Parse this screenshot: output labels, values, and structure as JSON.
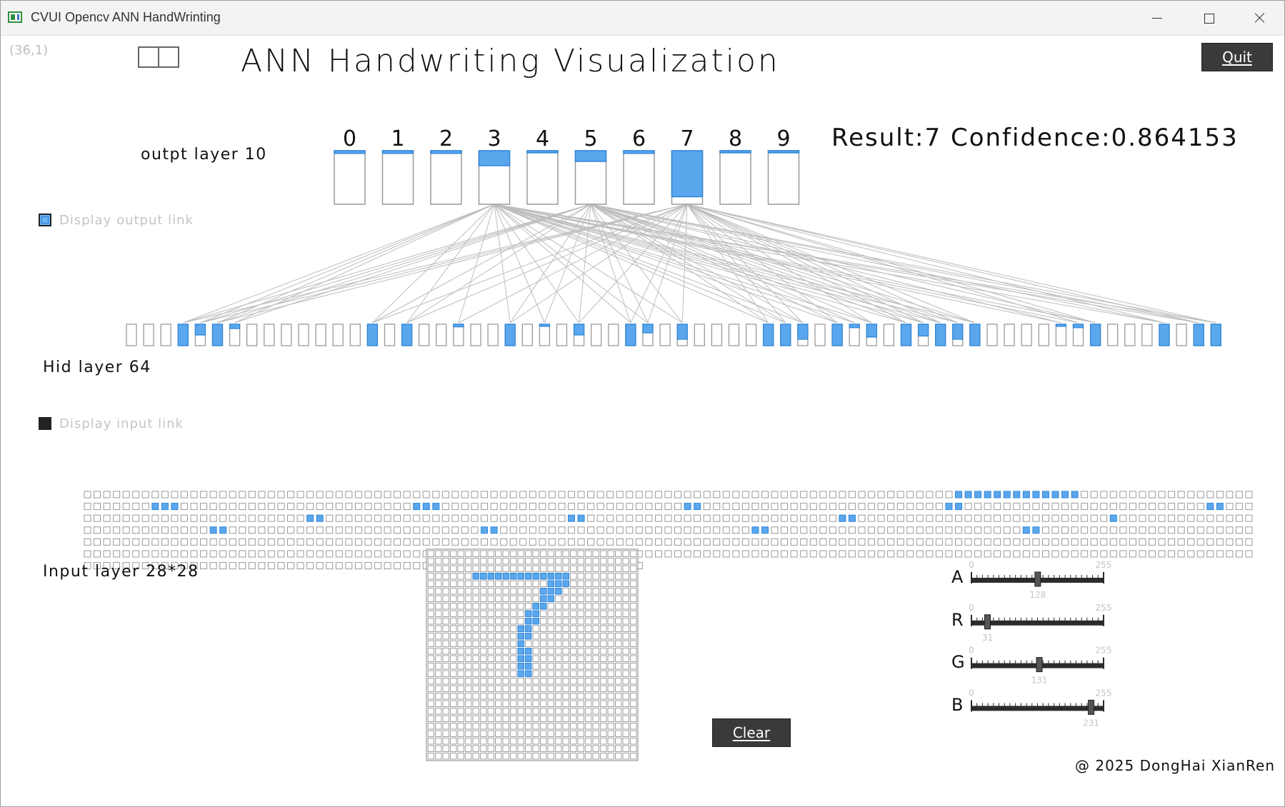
{
  "window": {
    "title": "CVUI Opencv ANN HandWrinting"
  },
  "header": {
    "coord_readout": "(36,1)",
    "title": "ANN Handwriting Visualization",
    "quit_label": "Quit"
  },
  "output_layer": {
    "label": "outpt layer 10",
    "digits": [
      "0",
      "1",
      "2",
      "3",
      "4",
      "5",
      "6",
      "7",
      "8",
      "9"
    ],
    "activations": [
      0.05,
      0.05,
      0.05,
      0.28,
      0.04,
      0.2,
      0.05,
      0.86,
      0.04,
      0.04
    ],
    "result_text": "Result:7  Confidence:0.864153",
    "display_link_label": "Display output link",
    "display_link_checked": true
  },
  "hidden_layer": {
    "label": "Hid layer 64",
    "activations": [
      0,
      0,
      0,
      1,
      0.5,
      1,
      0.2,
      0,
      0,
      0,
      0,
      0,
      0,
      0,
      1,
      0,
      1,
      0,
      0,
      0.12,
      0,
      0,
      1,
      0,
      0.1,
      0,
      0.5,
      0,
      0,
      1,
      0.4,
      0,
      0.7,
      0,
      0,
      0,
      0,
      1,
      1,
      0.7,
      0,
      1,
      0.16,
      0.6,
      0,
      1,
      0.55,
      1,
      0.7,
      1,
      0,
      0,
      0,
      0,
      0.06,
      0.16,
      1,
      0,
      0,
      0,
      1,
      0,
      1,
      1
    ],
    "display_link_label": "Display input link",
    "display_link_checked": false
  },
  "input_layer": {
    "label": "Input layer 28*28",
    "drawn_pixels": [
      [
        3,
        6
      ],
      [
        3,
        7
      ],
      [
        3,
        8
      ],
      [
        3,
        9
      ],
      [
        3,
        10
      ],
      [
        3,
        11
      ],
      [
        3,
        12
      ],
      [
        3,
        13
      ],
      [
        3,
        14
      ],
      [
        3,
        15
      ],
      [
        3,
        16
      ],
      [
        3,
        17
      ],
      [
        3,
        18
      ],
      [
        4,
        16
      ],
      [
        4,
        17
      ],
      [
        4,
        18
      ],
      [
        5,
        15
      ],
      [
        5,
        16
      ],
      [
        5,
        17
      ],
      [
        6,
        15
      ],
      [
        6,
        16
      ],
      [
        7,
        14
      ],
      [
        7,
        15
      ],
      [
        8,
        13
      ],
      [
        8,
        14
      ],
      [
        9,
        13
      ],
      [
        9,
        14
      ],
      [
        10,
        12
      ],
      [
        10,
        13
      ],
      [
        11,
        12
      ],
      [
        11,
        13
      ],
      [
        12,
        12
      ],
      [
        13,
        12
      ],
      [
        13,
        13
      ],
      [
        14,
        12
      ],
      [
        14,
        13
      ],
      [
        15,
        12
      ],
      [
        15,
        13
      ],
      [
        16,
        12
      ],
      [
        16,
        13
      ]
    ],
    "clear_label": "Clear"
  },
  "sliders": [
    {
      "name": "A",
      "min": "0",
      "max": "255",
      "value": 128
    },
    {
      "name": "R",
      "min": "0",
      "max": "255",
      "value": 31
    },
    {
      "name": "G",
      "min": "0",
      "max": "255",
      "value": 131
    },
    {
      "name": "B",
      "min": "0",
      "max": "255",
      "value": 231
    }
  ],
  "footer": {
    "copyright": "@ 2025 DongHai XianRen"
  },
  "colors": {
    "active_fill": "#5aa7ee",
    "active_stroke": "#2f86d8",
    "neuron_stroke": "#9a9a9a",
    "link": "#bdbdbd"
  }
}
